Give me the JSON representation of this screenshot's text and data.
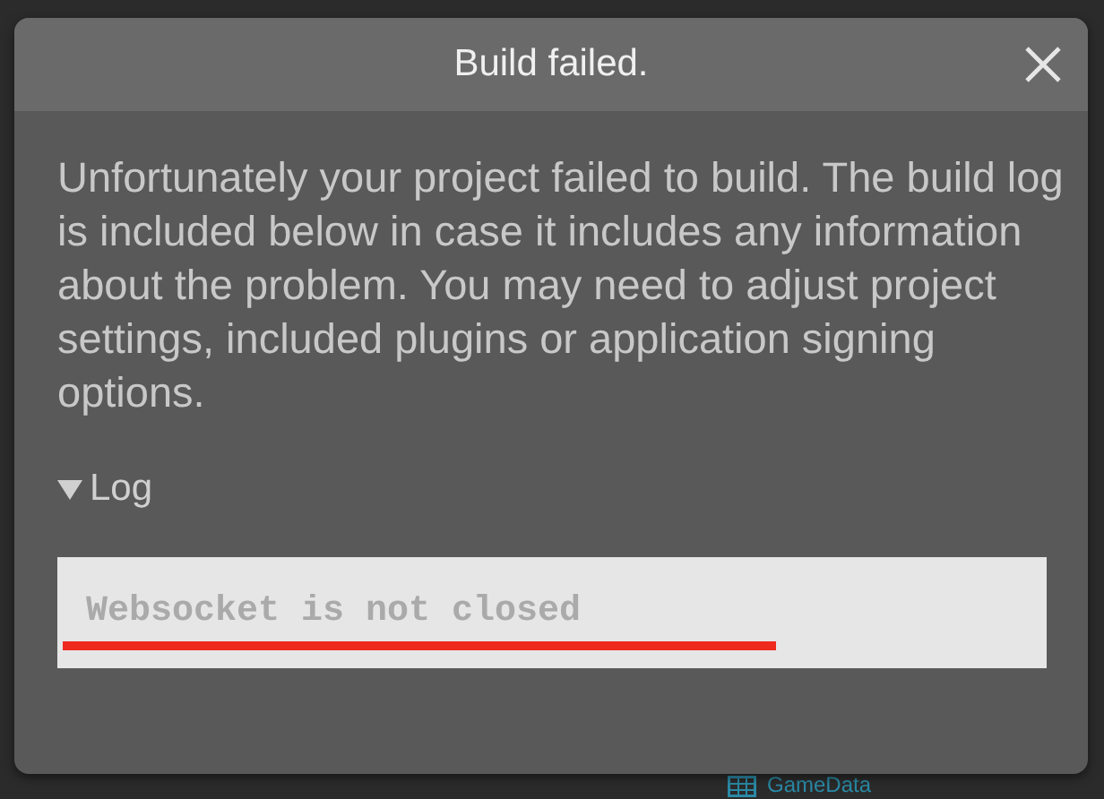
{
  "background": {
    "item_label": "GameData"
  },
  "dialog": {
    "title": "Build failed.",
    "message": "Unfortunately your project failed to build. The build log is included below in case it includes any information about the problem. You may need to adjust project settings, included plugins or application signing options.",
    "log": {
      "label": "Log",
      "expanded": true,
      "text": "Websocket is not closed",
      "underlined": true
    }
  }
}
